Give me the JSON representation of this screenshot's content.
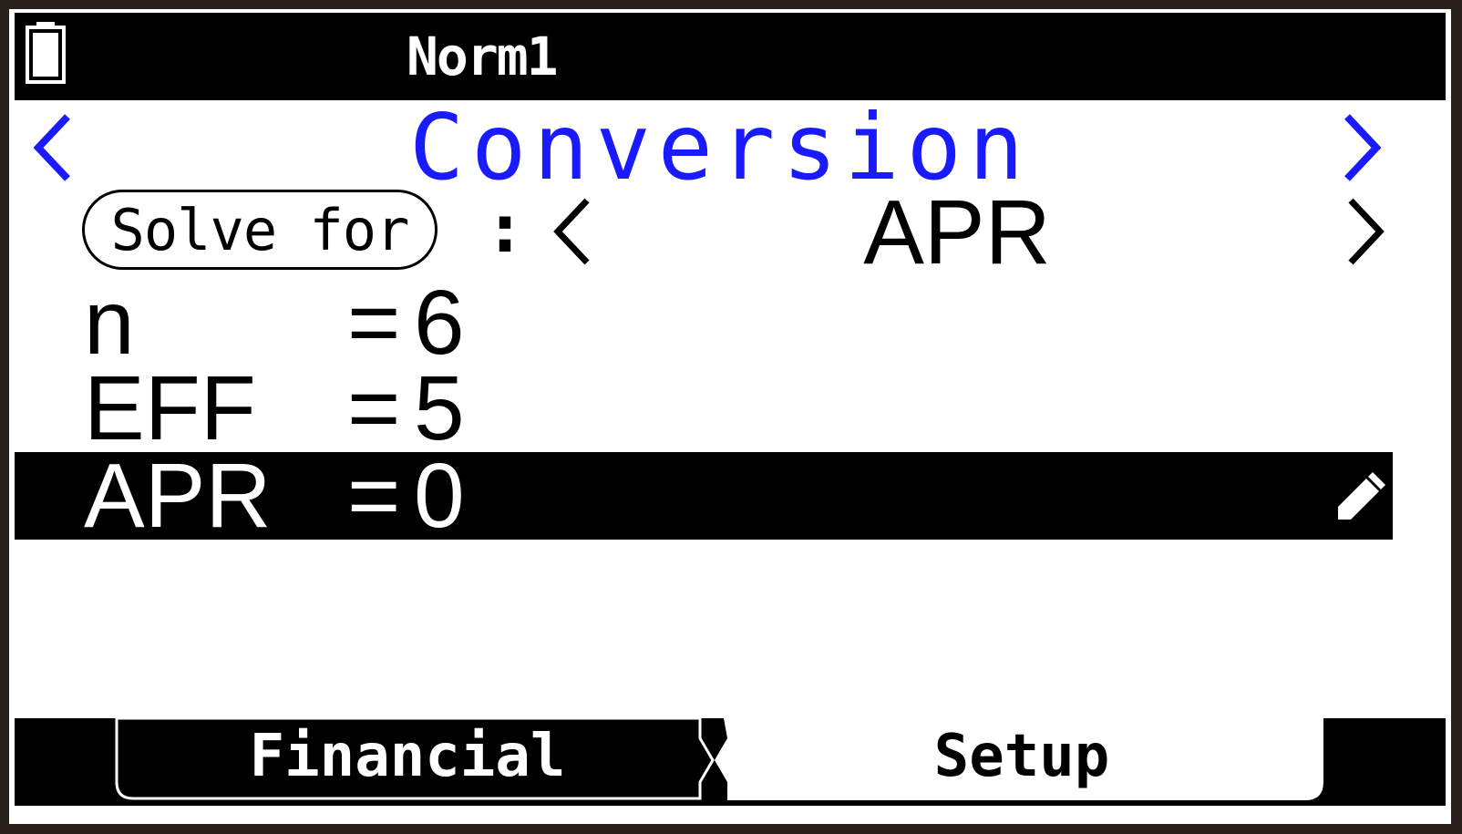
{
  "status_bar": {
    "battery_icon": "battery-icon",
    "mode_label": "Norm1"
  },
  "title_bar": {
    "title": "Conversion",
    "prev_icon": "chevron-left-icon",
    "next_icon": "chevron-right-icon",
    "accent_color": "#1a1aff"
  },
  "solve_for": {
    "label": "Solve for",
    "separator": ":",
    "value": "APR"
  },
  "variables": [
    {
      "name": "n",
      "eq": "=",
      "value": "6"
    },
    {
      "name": "EFF",
      "eq": "=",
      "value": "5"
    },
    {
      "name": "APR",
      "eq": "=",
      "value": "0",
      "selected": true,
      "edit_icon": "pencil-icon"
    }
  ],
  "softkeys": {
    "financial": "Financial",
    "setup": "Setup"
  }
}
